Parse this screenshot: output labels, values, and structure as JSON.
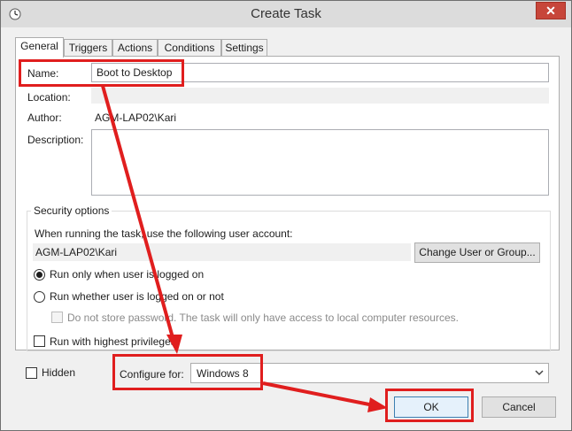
{
  "window": {
    "title": "Create Task",
    "close_glyph": "✕"
  },
  "tabs": [
    {
      "label": "General",
      "active": true
    },
    {
      "label": "Triggers",
      "active": false
    },
    {
      "label": "Actions",
      "active": false
    },
    {
      "label": "Conditions",
      "active": false
    },
    {
      "label": "Settings",
      "active": false
    }
  ],
  "general": {
    "name_label": "Name:",
    "name_value": "Boot to Desktop",
    "location_label": "Location:",
    "location_value": "",
    "author_label": "Author:",
    "author_value": "AGM-LAP02\\Kari",
    "description_label": "Description:",
    "description_value": ""
  },
  "security": {
    "group_title": "Security options",
    "account_prompt": "When running the task, use the following user account:",
    "account_value": "AGM-LAP02\\Kari",
    "change_user_button": "Change User or Group...",
    "radio_logged_on": "Run only when user is logged on",
    "radio_whether": "Run whether user is logged on or not",
    "dont_store_password": "Do not store password.  The task will only have access to local computer resources.",
    "highest_privileges": "Run with highest privileges"
  },
  "bottom": {
    "hidden_label": "Hidden",
    "configure_label": "Configure for:",
    "configure_value": "Windows 8",
    "ok_button": "OK",
    "cancel_button": "Cancel"
  },
  "colors": {
    "annotation": "#e01e1e",
    "close_button": "#c7463a"
  }
}
